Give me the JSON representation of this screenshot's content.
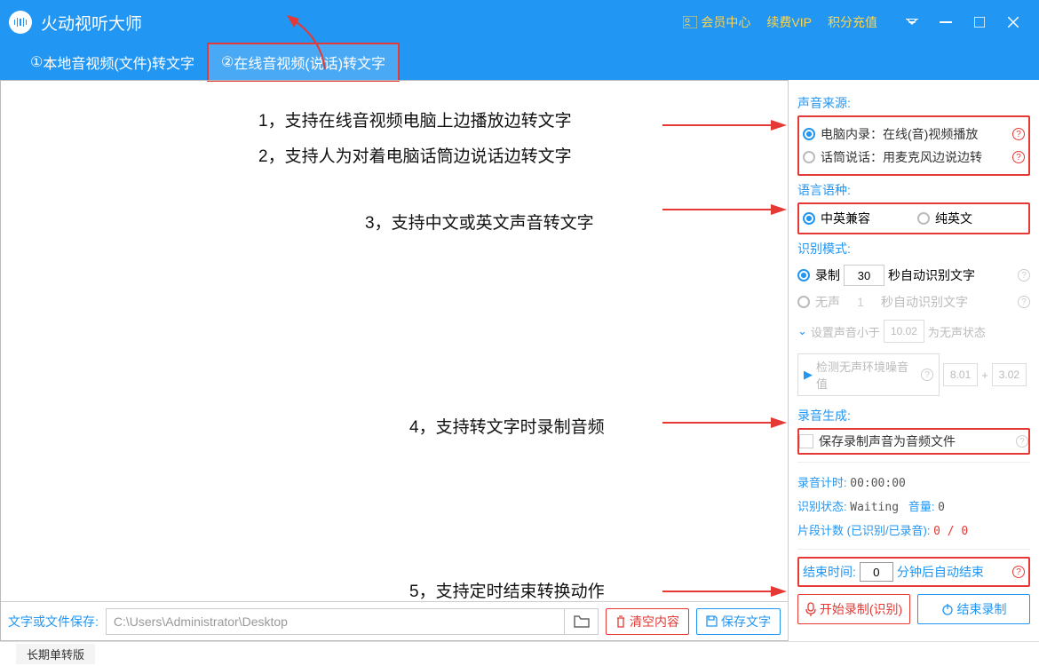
{
  "header": {
    "title": "火动视听大师",
    "links": {
      "member": "会员中心",
      "vip": "续费VIP",
      "points": "积分充值"
    }
  },
  "tabs": [
    {
      "num": "①",
      "label": "本地音视频(文件)转文字"
    },
    {
      "num": "②",
      "label": "在线音视频(说话)转文字"
    }
  ],
  "features": {
    "f1": "1，支持在线音视频电脑上边播放边转文字",
    "f2": "2，支持人为对着电脑话筒边说话边转文字",
    "f3": "3，支持中文或英文声音转文字",
    "f4": "4，支持转文字时录制音频",
    "f5": "5，支持定时结束转换动作"
  },
  "source": {
    "title": "声音来源:",
    "opt1": "电脑内录：在线(音)视频播放",
    "opt2": "话筒说话：用麦克风边说边转"
  },
  "lang": {
    "title": "语言语种:",
    "opt1": "中英兼容",
    "opt2": "纯英文"
  },
  "mode": {
    "title": "识别模式:",
    "rec": "录制",
    "rec_val": "30",
    "rec_suffix": "秒自动识别文字",
    "silent": "无声",
    "silent_val": "1",
    "silent_suffix": "秒自动识别文字",
    "threshold_label": "设置声音小于",
    "threshold_val": "10.02",
    "threshold_suffix": "为无声状态",
    "noise_label": "检测无声环境噪音值",
    "noise_v1": "8.01",
    "noise_v2": "3.02",
    "plus": "+"
  },
  "recgen": {
    "title": "录音生成:",
    "checkbox": "保存录制声音为音频文件"
  },
  "stats": {
    "timer_label": "录音计时:",
    "timer_val": "00:00:00",
    "status_label": "识别状态:",
    "status_val": "Waiting",
    "vol_label": "音量:",
    "vol_val": "0",
    "seg_label": "片段计数 (已识别/已录音):",
    "seg_val": "0 / 0"
  },
  "end": {
    "label": "结束时间:",
    "val": "0",
    "suffix": "分钟后自动结束"
  },
  "buttons": {
    "start": "开始录制(识别)",
    "stop": "结束录制"
  },
  "bottom": {
    "label": "文字或文件保存:",
    "path": "C:\\Users\\Administrator\\Desktop",
    "clear": "清空内容",
    "save": "保存文字"
  },
  "status": "长期单转版"
}
